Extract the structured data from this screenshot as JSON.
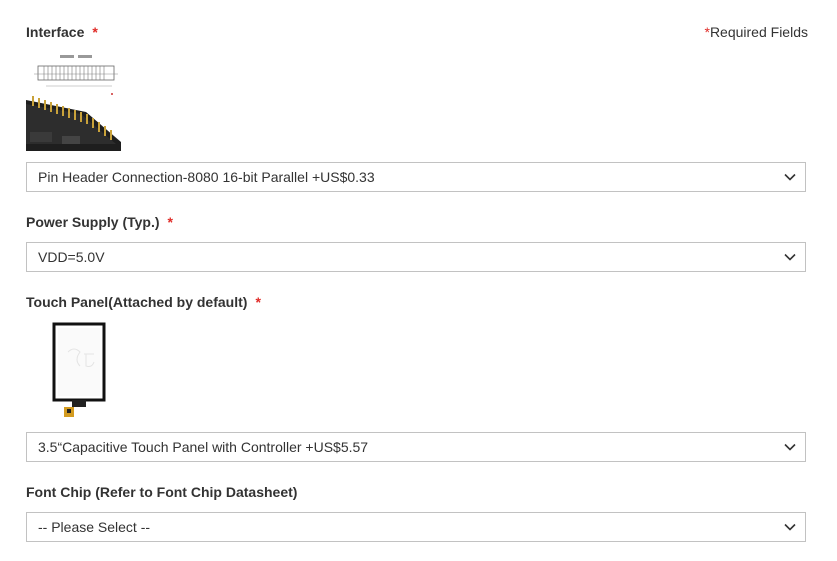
{
  "required_note": {
    "star": "*",
    "text": "Required Fields"
  },
  "fields": [
    {
      "label": "Interface",
      "required_mark": "*",
      "selected": "Pin Header Connection-8080 16-bit Parallel +US$0.33"
    },
    {
      "label": "Power Supply (Typ.)",
      "required_mark": "*",
      "selected": "VDD=5.0V"
    },
    {
      "label": "Touch Panel(Attached by default)",
      "required_mark": "*",
      "selected": "3.5“Capacitive Touch Panel with Controller +US$5.57"
    },
    {
      "label": "Font Chip (Refer to Font Chip Datasheet)",
      "selected": "-- Please Select --"
    }
  ],
  "icons": {
    "dropdown": "chevron-down-icon",
    "interface_image": "pin-header-board-image",
    "touch_image": "capacitive-touch-panel-image"
  },
  "colors": {
    "required_star": "#e02b27",
    "text": "#333333",
    "border": "#c2c2c2"
  }
}
